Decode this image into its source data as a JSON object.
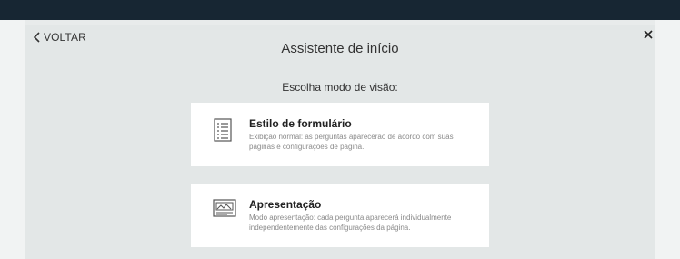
{
  "wizard": {
    "back_label": "VOLTAR",
    "title": "Assistente de início",
    "subtitle": "Escolha modo de visão:",
    "options": [
      {
        "title": "Estilo de formulário",
        "description": "Exibição normal: as perguntas aparecerão de acordo com suas páginas e configurações de página.",
        "icon": "form-list-icon"
      },
      {
        "title": "Apresentação",
        "description": "Modo apresentação: cada pergunta aparecerá individualmente independentemente das configurações da página.",
        "icon": "presentation-icon"
      }
    ]
  },
  "colors": {
    "topbar": "#172633",
    "modal_bg": "#e3e7e7",
    "card_bg": "#ffffff",
    "desc_text": "#8a8a8a"
  }
}
